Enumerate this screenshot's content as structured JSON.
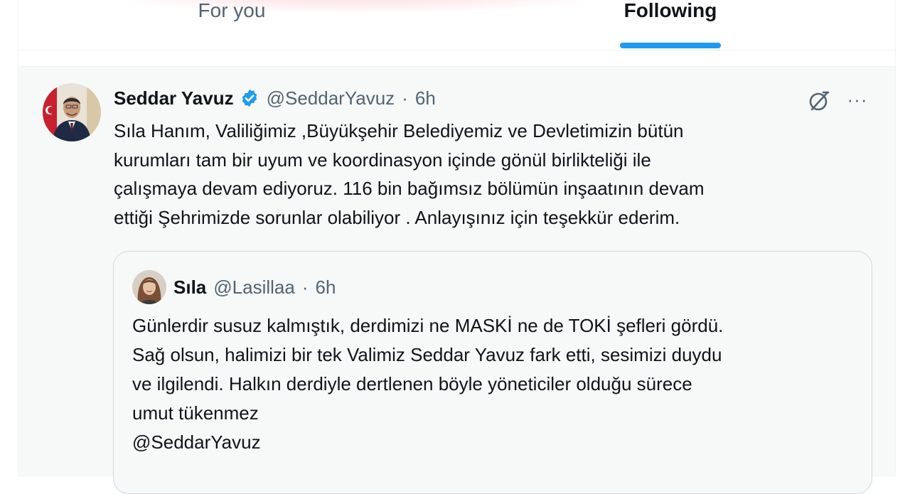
{
  "tabs": {
    "for_you": "For you",
    "following": "Following",
    "active": "following"
  },
  "post": {
    "author_name": "Seddar Yavuz",
    "verified": true,
    "handle": "@SeddarYavuz",
    "separator": "·",
    "time": "6h",
    "text_lines": [
      "Sıla Hanım, Valiliğimiz ,Büyükşehir Belediyemiz ve Devletimizin bütün",
      "kurumları tam bir uyum ve koordinasyon içinde gönül birlikteliği ile",
      "çalışmaya devam ediyoruz. 116 bin bağımsız bölümün inşaatının devam",
      "ettiği Şehrimizde sorunlar olabiliyor . Anlayışınız için teşekkür ederim."
    ],
    "more_label": "···",
    "icons": {
      "verified": "verified-badge-icon",
      "grok": "grok-icon",
      "more": "more-icon"
    }
  },
  "quote": {
    "author_name": "Sıla",
    "handle": "@Lasillaa",
    "separator": "·",
    "time": "6h",
    "text_lines": [
      "Günlerdir susuz kalmıştık, derdimizi ne MASKİ ne de TOKİ şefleri gördü.",
      "Sağ olsun, halimizi bir tek Valimiz Seddar Yavuz fark etti, sesimizi duydu",
      "ve ilgilendi. Halkın derdiyle dertlenen böyle yöneticiler olduğu sürece",
      "umut tükenmez",
      "@SeddarYavuz"
    ]
  },
  "colors": {
    "accent": "#1d9bf0",
    "secondary_text": "#536471",
    "post_background": "#f7f9f9",
    "border": "#cfd9de"
  }
}
